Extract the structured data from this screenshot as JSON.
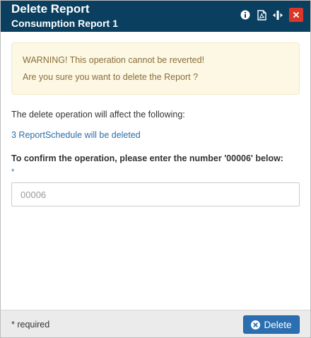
{
  "dialog": {
    "title": "Delete Report",
    "subtitle": "Consumption Report 1",
    "header_icons": [
      "info-icon",
      "pdf-icon",
      "resize-icon",
      "close-icon"
    ],
    "close_label": "×"
  },
  "warning": {
    "line1": "WARNING! This operation cannot be reverted!",
    "line2": "Are you sure you want to delete the Report ?"
  },
  "affect_text": "The delete operation will affect the following:",
  "schedule_link": "3 ReportSchedule will be deleted",
  "confirm": {
    "label": "To confirm the operation, please enter the number '00006' below:",
    "required_marker": "*",
    "placeholder": "00006",
    "value": ""
  },
  "footer": {
    "required_note": "* required",
    "delete_label": "Delete"
  },
  "colors": {
    "header_bg": "#0b3f5f",
    "close_bg": "#d9372a",
    "warning_bg": "#fcf8e3",
    "warning_text": "#8a6d3b",
    "link": "#2a6fa8",
    "primary_button": "#2c6fb0",
    "footer_bg": "#ebebeb"
  }
}
